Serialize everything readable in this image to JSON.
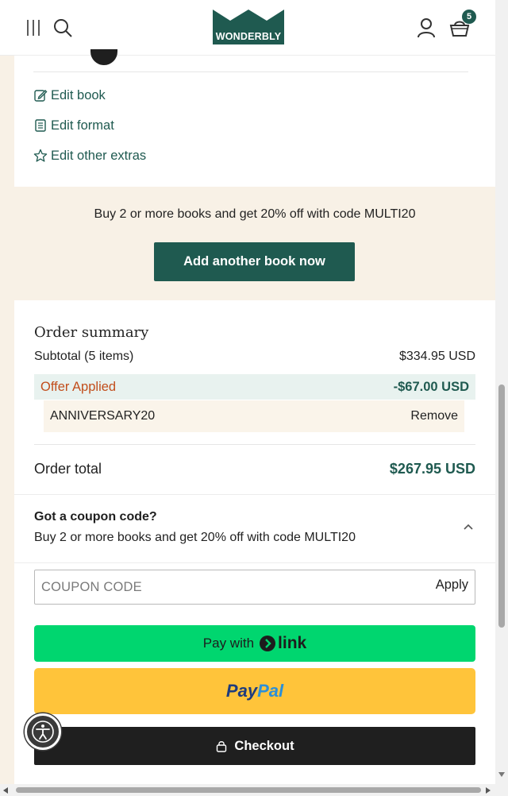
{
  "header": {
    "logo_text": "WONDERBLY",
    "basket_count": "5",
    "icons": [
      "menu-icon",
      "search-icon",
      "account-icon",
      "basket-icon"
    ]
  },
  "edit_links": [
    {
      "label": "Edit book",
      "icon": "edit-pencil-icon"
    },
    {
      "label": "Edit format",
      "icon": "document-icon"
    },
    {
      "label": "Edit other extras",
      "icon": "star-icon"
    }
  ],
  "promo": {
    "text": "Buy 2 or more books and get 20% off with code MULTI20",
    "button_label": "Add another book now"
  },
  "summary": {
    "title": "Order summary",
    "subtotal_label": "Subtotal (5 items)",
    "subtotal_value": "$334.95 USD",
    "offer_label": "Offer Applied",
    "offer_value": "-$67.00 USD",
    "code_applied": "ANNIVERSARY20",
    "remove_label": "Remove",
    "total_label": "Order total",
    "total_value": "$267.95 USD"
  },
  "coupon": {
    "heading": "Got a coupon code?",
    "subtext": "Buy 2 or more books and get 20% off with code MULTI20",
    "placeholder": "COUPON CODE",
    "apply_label": "Apply"
  },
  "payment": {
    "link_prefix": "Pay with",
    "link_word": "link",
    "paypal_pay": "Pay",
    "paypal_pal": "Pal",
    "checkout_label": "Checkout"
  },
  "colors": {
    "brand_green": "#1f5a50",
    "cream": "#f8f1e6",
    "offer_orange": "#c24e1c",
    "link_green": "#00d66f",
    "paypal_yellow": "#ffc43a"
  }
}
